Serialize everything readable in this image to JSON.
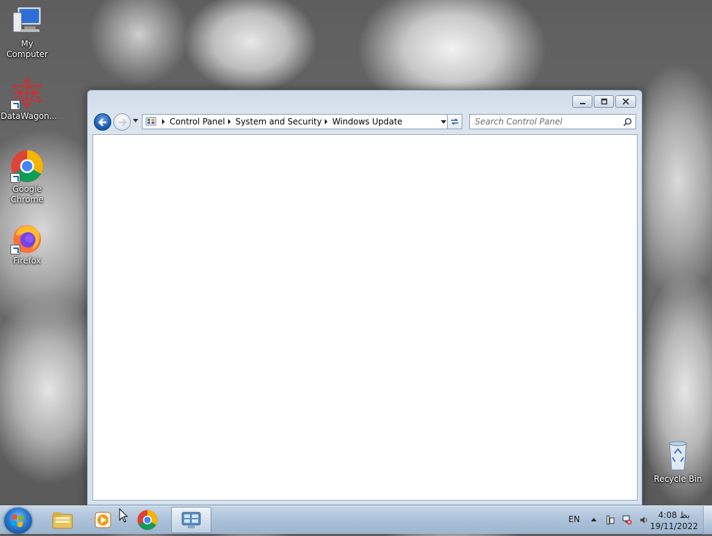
{
  "desktop": {
    "icons": [
      {
        "label": "My Computer",
        "icon": "computer-icon"
      },
      {
        "label": "DataWagon...",
        "icon": "datawagon-icon"
      },
      {
        "label": "Google Chrome",
        "icon": "chrome-icon"
      },
      {
        "label": "Firefox",
        "icon": "firefox-icon"
      },
      {
        "label": "Recycle Bin",
        "icon": "recycle-bin-icon"
      }
    ]
  },
  "window": {
    "breadcrumb": [
      "Control Panel",
      "System and Security",
      "Windows Update"
    ],
    "search_placeholder": "Search Control Panel",
    "controls": {
      "minimize": "minimize-icon",
      "maximize": "maximize-icon",
      "close": "close-icon"
    }
  },
  "taskbar": {
    "pinned": [
      "windows-explorer-icon",
      "media-player-icon",
      "chrome-icon",
      "control-panel-icon"
    ],
    "active": "control-panel-icon",
    "language": "EN",
    "clock_time": "4:08 بظ",
    "clock_date": "19/11/2022"
  },
  "colors": {
    "taskbar": "#aec3da",
    "window_frame": "#d6e2ee",
    "content_bg": "#ffffff"
  }
}
